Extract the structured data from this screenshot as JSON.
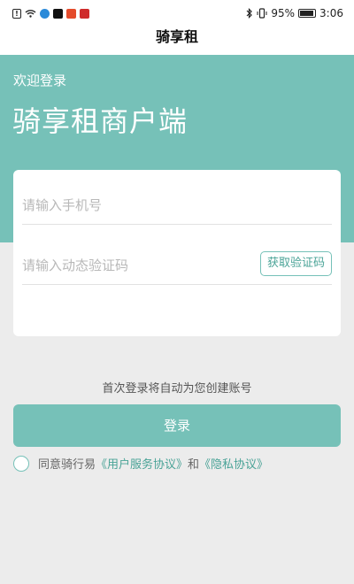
{
  "status_bar": {
    "battery": "95%",
    "time": "3:06",
    "icons": [
      "alert-icon",
      "wifi-icon",
      "app-icon",
      "tiktok-icon",
      "app-icon",
      "app-icon",
      "bluetooth-icon",
      "vibrate-icon",
      "battery-icon"
    ]
  },
  "app": {
    "title": "骑享租",
    "welcome": "欢迎登录",
    "brand": "骑享租商户端"
  },
  "form": {
    "phone_placeholder": "请输入手机号",
    "code_placeholder": "请输入动态验证码",
    "get_code_label": "获取验证码"
  },
  "hint": "首次登录将自动为您创建账号",
  "login_label": "登录",
  "agreement": {
    "prefix": "同意骑行易",
    "user_agreement": "《用户服务协议》",
    "and": "和",
    "privacy": "《隐私协议》"
  },
  "colors": {
    "accent": "#76c1b8",
    "background": "#ececec"
  }
}
